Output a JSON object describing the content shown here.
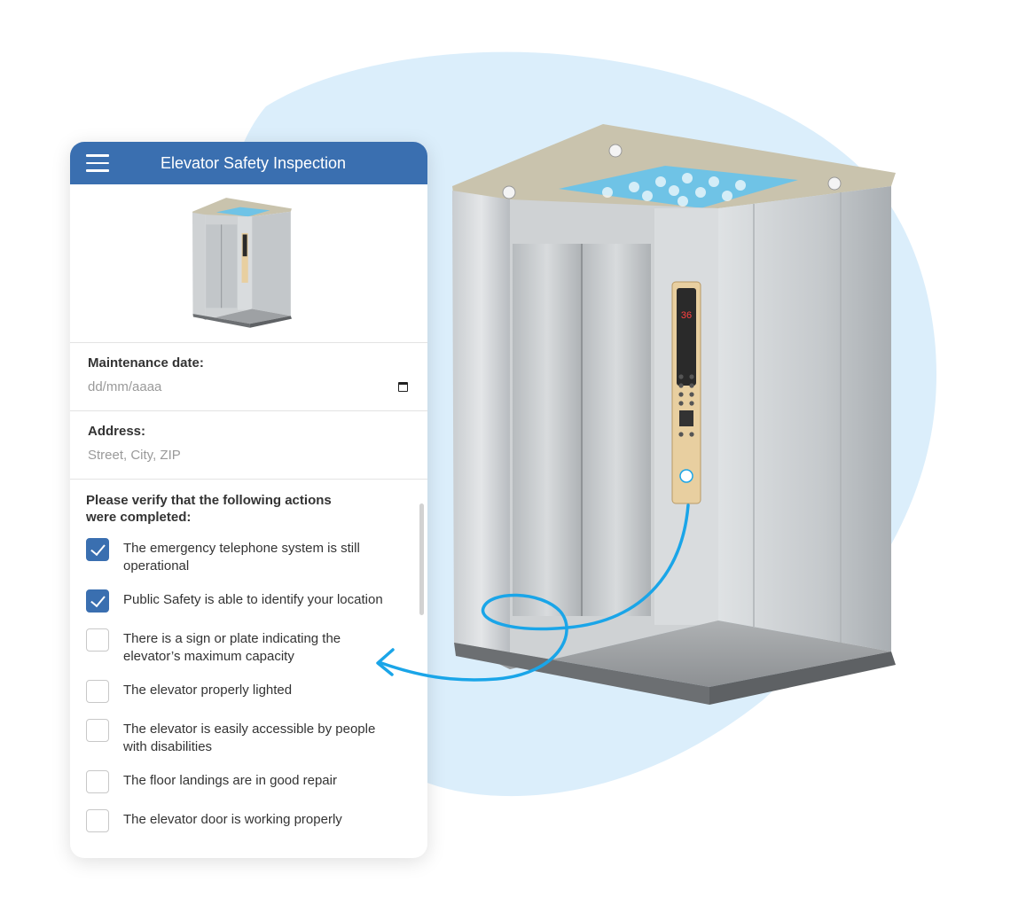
{
  "app": {
    "title": "Elevator Safety Inspection"
  },
  "form": {
    "date_label": "Maintenance date:",
    "date_placeholder": "dd/mm/aaaa",
    "address_label": "Address:",
    "address_placeholder": "Street, City, ZIP",
    "verify_prompt": "Please verify that the following actions were completed:"
  },
  "checklist": [
    {
      "label": "The emergency telephone system is still operational",
      "checked": true
    },
    {
      "label": "Public Safety is able to identify your location",
      "checked": true
    },
    {
      "label": "There is a sign or plate indicating the elevator’s maximum capacity",
      "checked": false
    },
    {
      "label": "The elevator properly lighted",
      "checked": false
    },
    {
      "label": "The elevator is easily accessible by people with disabilities",
      "checked": false
    },
    {
      "label": "The floor landings are in good repair",
      "checked": false
    },
    {
      "label": "The elevator door is working properly",
      "checked": false
    }
  ],
  "panel_display": {
    "floor": "36"
  },
  "colors": {
    "brand": "#3a6fb0",
    "arrow": "#1aa5e8",
    "blob": "#dbeefb"
  },
  "icons": [
    "menu-icon",
    "calendar-icon",
    "checkmark-icon",
    "arrow-icon"
  ]
}
